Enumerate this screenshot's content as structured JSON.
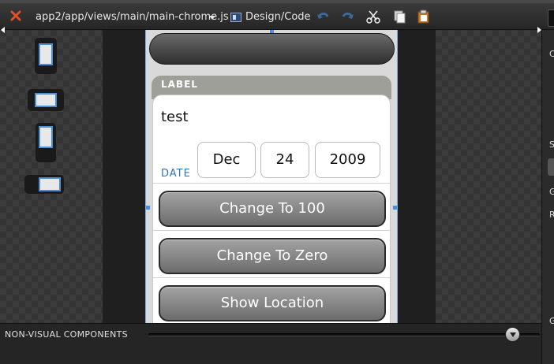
{
  "toolbar": {
    "file_path": "app2/app/views/main/main-chrome.js",
    "view_toggle_label": "Design/Code",
    "icons": {
      "close": "close-x-icon",
      "undo": "undo-icon",
      "redo": "redo-icon",
      "cut": "scissors-icon",
      "copy": "copy-icon",
      "paste": "paste-icon"
    },
    "colors": {
      "close": "#e0502a",
      "accent": "#4a90d9"
    }
  },
  "devices": [
    {
      "name": "phone-portrait"
    },
    {
      "name": "phone-landscape"
    },
    {
      "name": "tablet-portrait"
    },
    {
      "name": "tablet-landscape"
    }
  ],
  "preview": {
    "group_label": "LABEL",
    "text_value": "test",
    "date": {
      "label": "DATE",
      "month": "Dec",
      "day": "24",
      "year": "2009"
    },
    "buttons": [
      {
        "label": "Change To 100"
      },
      {
        "label": "Change To Zero"
      },
      {
        "label": "Show Location"
      }
    ]
  },
  "sidebar": {
    "letters": [
      "C",
      "S",
      "G",
      "R",
      "G"
    ]
  },
  "bottom": {
    "non_visual_label": "NON-VISUAL COMPONENTS",
    "zoom_level": 0.93
  }
}
